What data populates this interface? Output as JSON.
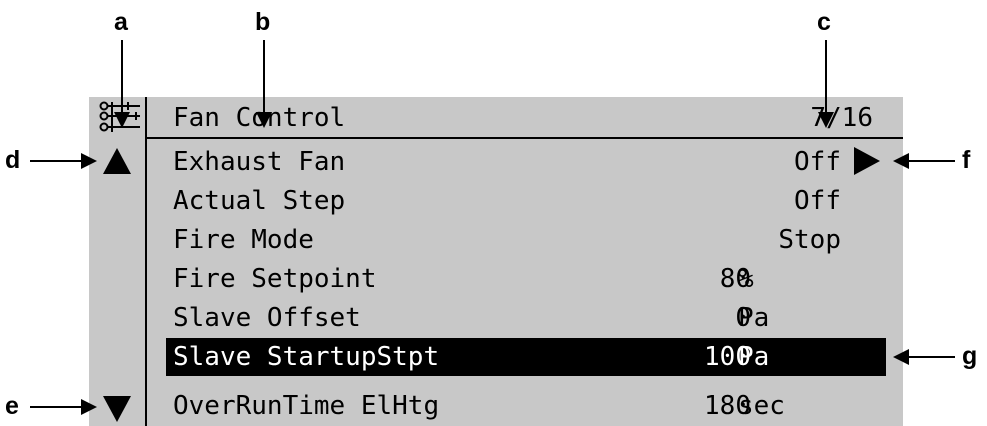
{
  "callouts": {
    "a": "a",
    "b": "b",
    "c": "c",
    "d": "d",
    "e": "e",
    "f": "f",
    "g": "g"
  },
  "header": {
    "title": "Fan Control",
    "page": "7/16",
    "menu_icon": "menu-list-icon"
  },
  "rows": [
    {
      "label": "Exhaust Fan",
      "value": "Off",
      "unit": ""
    },
    {
      "label": "Actual Step",
      "value": "Off",
      "unit": ""
    },
    {
      "label": "Fire Mode",
      "value": "Stop",
      "unit": ""
    },
    {
      "label": "Fire Setpoint",
      "value": "80",
      "unit": "%"
    },
    {
      "label": "Slave Offset",
      "value": "0",
      "unit": "Pa"
    },
    {
      "label": "Slave StartupStpt",
      "value": "100",
      "unit": "Pa"
    },
    {
      "label": "OverRunTime ElHtg",
      "value": "180",
      "unit": "sec"
    }
  ],
  "selected_row": "Slave StartupStpt",
  "icons": {
    "scroll_up": "up-triangle-icon",
    "scroll_down": "down-triangle-icon",
    "enter": "right-triangle-icon"
  },
  "colors": {
    "screen": "#c8c8c8",
    "text": "#000000",
    "highlight_bg": "#000000",
    "highlight_text": "#ffffff"
  }
}
